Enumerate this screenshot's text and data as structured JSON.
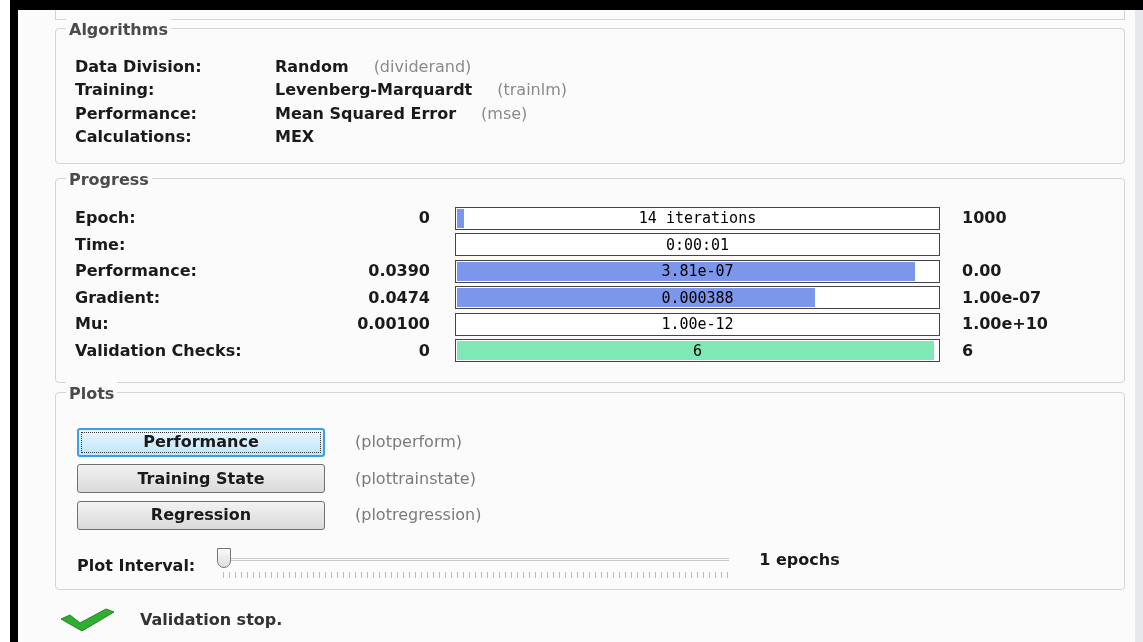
{
  "algorithms": {
    "title": "Algorithms",
    "rows": [
      {
        "label": "Data Division:",
        "value": "Random",
        "note": "(dividerand)"
      },
      {
        "label": "Training:",
        "value": "Levenberg-Marquardt",
        "note": "(trainlm)"
      },
      {
        "label": "Performance:",
        "value": "Mean Squared Error",
        "note": "(mse)"
      },
      {
        "label": "Calculations:",
        "value": "MEX"
      }
    ]
  },
  "progress": {
    "title": "Progress",
    "rows": [
      {
        "label": "Epoch:",
        "start": "0",
        "reading": "14 iterations",
        "level": 0.014,
        "end": "1000",
        "kind": "blue"
      },
      {
        "label": "Time:",
        "reading": "0:00:01"
      },
      {
        "label": "Performance:",
        "start": "0.0390",
        "reading": "3.81e-07",
        "level": 0.96,
        "end": "0.00",
        "kind": "blue"
      },
      {
        "label": "Gradient:",
        "start": "0.0474",
        "reading": "0.000388",
        "level": 0.75,
        "end": "1.00e-07",
        "kind": "blue"
      },
      {
        "label": "Mu:",
        "start": "0.00100",
        "reading": "1.00e-12",
        "end": "1.00e+10"
      },
      {
        "label": "Validation Checks:",
        "start": "0",
        "reading": "6",
        "level": 1,
        "end": "6",
        "kind": "green"
      }
    ]
  },
  "plots": {
    "title": "Plots",
    "buttons": [
      {
        "label": "Performance",
        "note": "(plotperform)",
        "selected": true
      },
      {
        "label": "Training State",
        "note": "(plottrainstate)",
        "selected": false
      },
      {
        "label": "Regression",
        "note": "(plotregression)",
        "selected": false
      }
    ],
    "interval": {
      "label": "Plot Interval:",
      "level": 0,
      "reading": "1 epochs"
    }
  },
  "status": {
    "text": "Validation stop."
  }
}
